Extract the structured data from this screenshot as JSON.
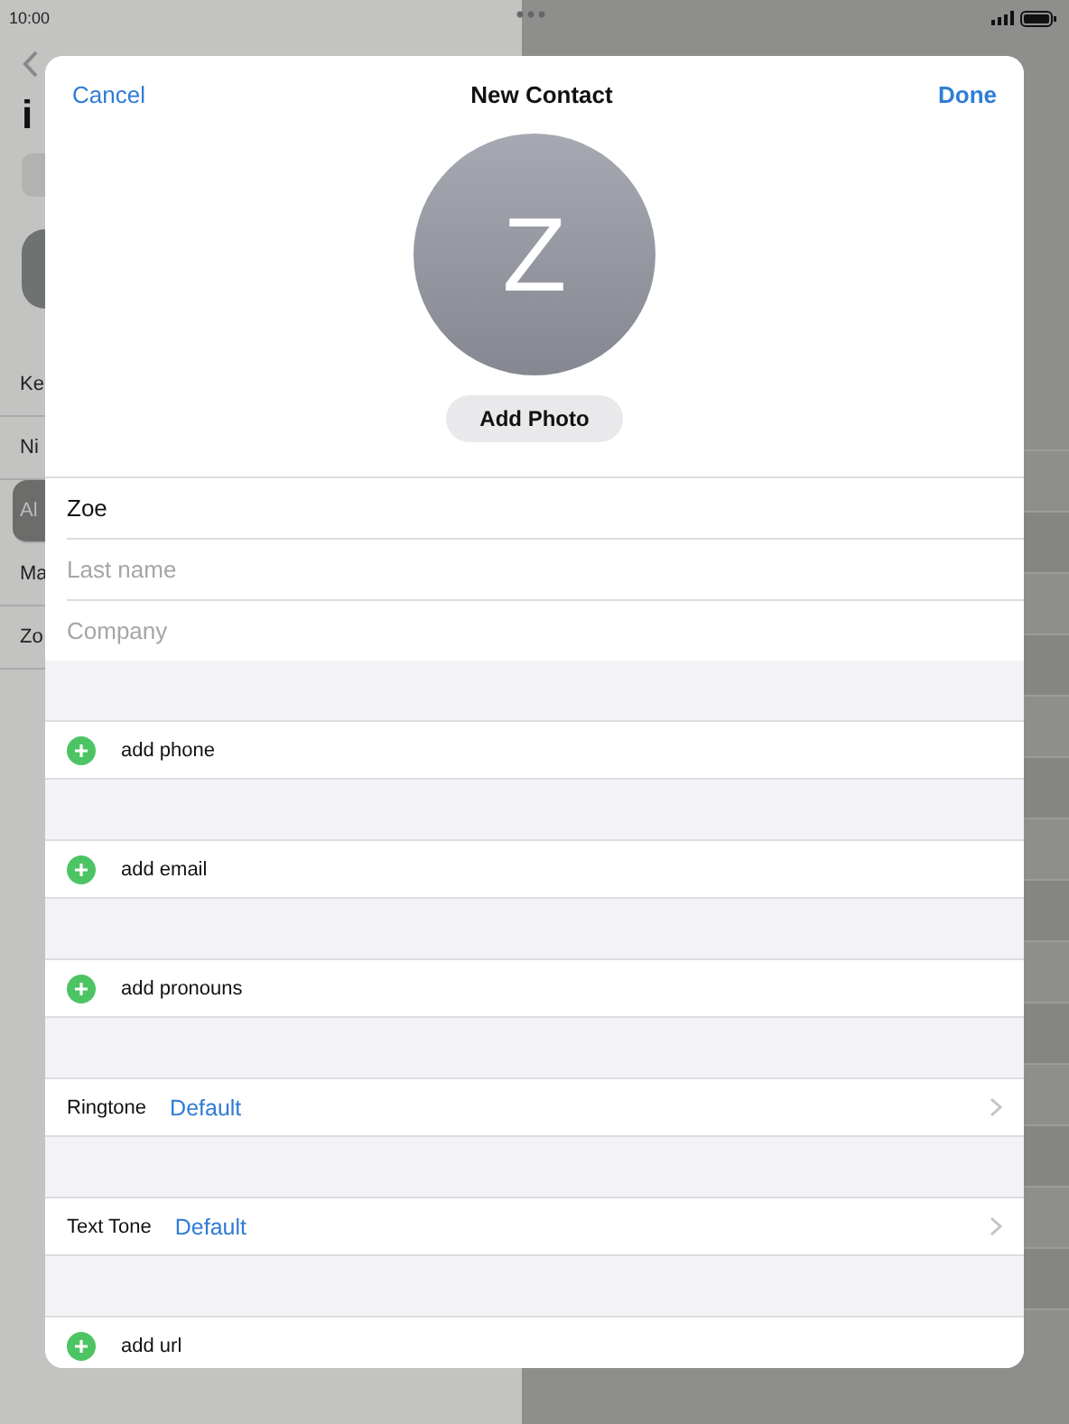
{
  "status_bar": {
    "time": "10:00"
  },
  "background": {
    "title": "i",
    "list": [
      {
        "label": "Ke",
        "selected": false
      },
      {
        "label": "Ni",
        "selected": false
      },
      {
        "label": "Al",
        "selected": true
      },
      {
        "label": "Ma",
        "selected": false
      },
      {
        "label": "Zo",
        "selected": false
      }
    ]
  },
  "sheet": {
    "cancel": "Cancel",
    "title": "New Contact",
    "done": "Done",
    "avatar_initial": "Z",
    "add_photo": "Add Photo",
    "fields": [
      {
        "value": "Zoe"
      },
      {
        "placeholder": "Last name"
      },
      {
        "placeholder": "Company"
      }
    ],
    "sections": [
      {
        "kind": "add",
        "label": "add phone"
      },
      {
        "kind": "add",
        "label": "add email"
      },
      {
        "kind": "add",
        "label": "add pronouns"
      },
      {
        "kind": "picker",
        "label": "Ringtone",
        "value": "Default"
      },
      {
        "kind": "picker",
        "label": "Text Tone",
        "value": "Default"
      },
      {
        "kind": "add",
        "label": "add url"
      }
    ]
  }
}
